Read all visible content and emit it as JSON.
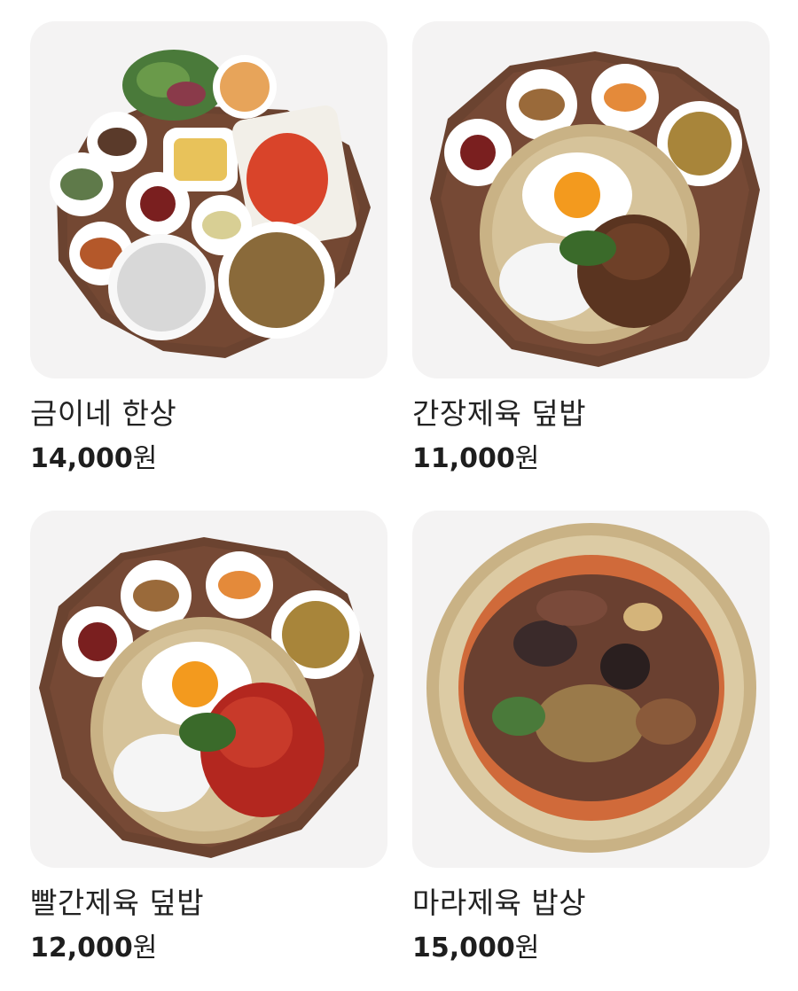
{
  "menu_items": [
    {
      "name": "금이네 한상",
      "price": "14,000",
      "currency": "원",
      "image_icon": "hansang-meal-icon"
    },
    {
      "name": "간장제육 덮밥",
      "price": "11,000",
      "currency": "원",
      "image_icon": "soy-pork-rice-bowl-icon"
    },
    {
      "name": "빨간제육 덮밥",
      "price": "12,000",
      "currency": "원",
      "image_icon": "spicy-pork-rice-bowl-icon"
    },
    {
      "name": "마라제육 밥상",
      "price": "15,000",
      "currency": "원",
      "image_icon": "mala-pork-plate-icon"
    }
  ],
  "colors": {
    "card_background": "#f4f3f3",
    "text": "#222222",
    "tray_wood": "#6b4330",
    "brass_plate": "#c9b285"
  }
}
